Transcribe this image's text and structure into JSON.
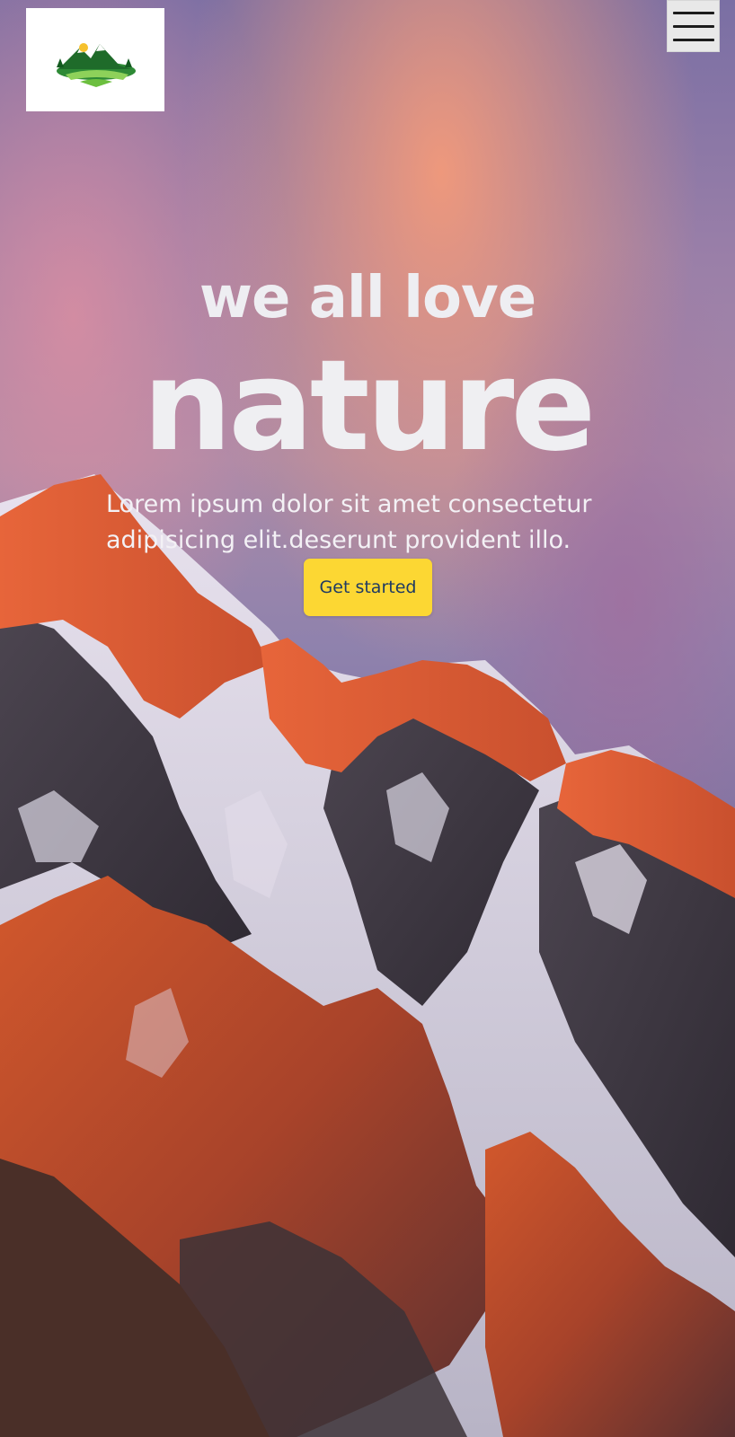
{
  "header": {
    "logo_alt": "mountain logo",
    "menu_icon": "hamburger-menu-icon"
  },
  "hero": {
    "tagline": "we all love",
    "headline": "nature",
    "description": "Lorem ipsum dolor sit amet consectetur adipisicing elit.deserunt provident illo.",
    "cta_label": "Get started",
    "background": "mountain-sunset-image"
  },
  "colors": {
    "cta_background": "#fcd733",
    "cta_text": "#1f3a63",
    "headline_text": "#efeff2",
    "sky": "#8a7ba8",
    "peak_glow": "#e0643a"
  }
}
